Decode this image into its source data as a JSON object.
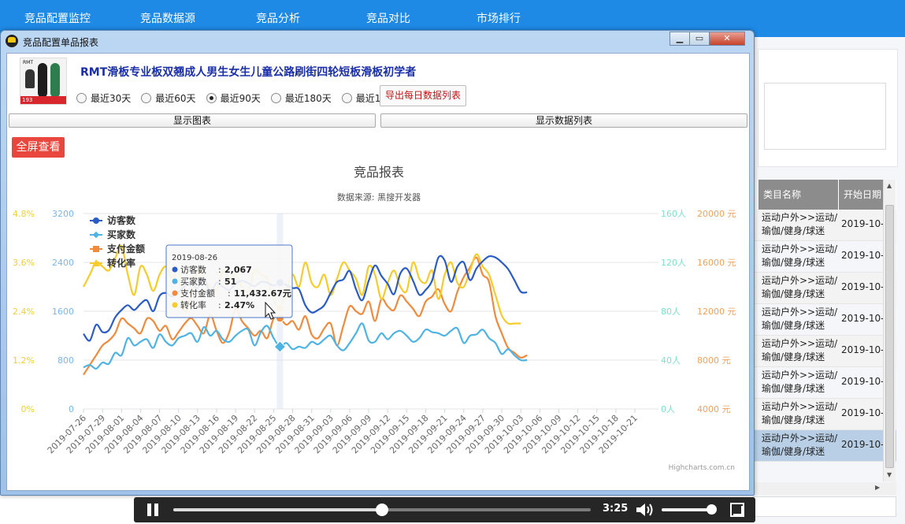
{
  "nav": [
    "竞品配置监控",
    "竞品数据源",
    "竞品分析",
    "竞品对比",
    "市场排行"
  ],
  "window": {
    "title": "竞品配置单品报表"
  },
  "product": {
    "title": "RMT滑板专业板双翘成人男生女生儿童公路刷街四轮短板滑板初学者",
    "thumb_brand": "RMT",
    "thumb_price": "193"
  },
  "ranges": [
    {
      "label": "最近30天",
      "selected": false
    },
    {
      "label": "最近60天",
      "selected": false
    },
    {
      "label": "最近90天",
      "selected": true
    },
    {
      "label": "最近180天",
      "selected": false
    },
    {
      "label": "最近1年",
      "selected": false
    }
  ],
  "buttons": {
    "export": "导出每日数据列表",
    "show_chart": "显示图表",
    "show_list": "显示数据列表",
    "fullscreen": "全屏查看"
  },
  "chart_data": {
    "type": "line",
    "title": "竞品报表",
    "subtitle": "数据来源: 黑搜开发器",
    "credit": "Highcharts.com.cn",
    "legend_position": "top-left",
    "x_start": "2019-07-26",
    "x_end": "2019-10-06",
    "x_tick_labels": [
      "2019-07-26",
      "2019-07-29",
      "2019-08-01",
      "2019-08-04",
      "2019-08-07",
      "2019-08-10",
      "2019-08-13",
      "2019-08-16",
      "2019-08-19",
      "2019-08-22",
      "2019-08-25",
      "2019-08-28",
      "2019-08-31",
      "2019-09-03",
      "2019-09-06",
      "2019-09-09",
      "2019-09-12",
      "2019-09-15",
      "2019-09-18",
      "2019-09-21",
      "2019-09-24",
      "2019-09-27",
      "2019-09-30",
      "2019-10-03",
      "2019-10-06",
      "2019-10-09",
      "2019-10-12",
      "2019-10-15",
      "2019-10-18",
      "2019-10-21"
    ],
    "axes": {
      "rate": {
        "ticks": [
          "0%",
          "1.2%",
          "2.4%",
          "3.6%",
          "4.8%"
        ],
        "range": [
          0,
          4.8
        ],
        "color": "#f1d03b"
      },
      "visitors": {
        "ticks": [
          "0",
          "800",
          "1600",
          "2400",
          "3200"
        ],
        "range": [
          0,
          3200
        ],
        "color": "#7cb5ec"
      },
      "buyers": {
        "ticks": [
          "0人",
          "40人",
          "80人",
          "120人",
          "160人"
        ],
        "range": [
          0,
          160
        ],
        "color": "#7ee0c9"
      },
      "amount": {
        "ticks": [
          "4000 元",
          "8000 元",
          "12000 元",
          "16000 元",
          "20000 元"
        ],
        "range": [
          4000,
          20000
        ],
        "color": "#f3a25d"
      }
    },
    "series": [
      {
        "name": "访客数",
        "color": "#2b5cc5",
        "axis": "visitors",
        "values": [
          1230,
          1120,
          1380,
          1260,
          1290,
          1500,
          1620,
          1700,
          1620,
          1720,
          1780,
          1600,
          1850,
          1900,
          1840,
          1920,
          2010,
          2060,
          1980,
          2150,
          1900,
          2070,
          2000,
          1950,
          2050,
          2100,
          2060,
          2010,
          2080,
          2070,
          2020,
          2067,
          2030,
          1980,
          1960,
          1700,
          1580,
          1620,
          1700,
          1900,
          2080,
          2120,
          2260,
          1960,
          1780,
          2100,
          2350,
          2180,
          2050,
          1880,
          2220,
          2300,
          2100,
          1870,
          1950,
          2100,
          2480,
          2430,
          2080,
          2330,
          2400,
          2110,
          2300,
          2420,
          2500,
          2480,
          2400,
          2290,
          2110,
          1920,
          1910
        ]
      },
      {
        "name": "买家数",
        "color": "#4fb3e4",
        "axis": "buyers",
        "values": [
          34,
          36,
          33,
          38,
          37,
          46,
          44,
          58,
          52,
          55,
          57,
          50,
          61,
          55,
          52,
          58,
          60,
          62,
          55,
          67,
          60,
          64,
          57,
          55,
          60,
          64,
          65,
          52,
          63,
          68,
          58,
          51,
          54,
          49,
          51,
          50,
          55,
          53,
          57,
          60,
          52,
          48,
          54,
          62,
          70,
          56,
          55,
          62,
          57,
          62,
          64,
          60,
          55,
          58,
          65,
          63,
          62,
          60,
          64,
          66,
          54,
          60,
          61,
          65,
          58,
          54,
          45,
          49,
          44,
          40,
          40
        ]
      },
      {
        "name": "支付金额",
        "color": "#f08a3c",
        "axis": "amount",
        "values": [
          6800,
          7600,
          8400,
          9200,
          9600,
          10200,
          11400,
          11000,
          10600,
          10200,
          11400,
          11200,
          10400,
          10800,
          9700,
          10300,
          11000,
          11432.67,
          10800,
          10200,
          11700,
          10400,
          9400,
          10300,
          12200,
          11200,
          10600,
          10000,
          10400,
          9800,
          11400,
          11432.67,
          10900,
          11200,
          10500,
          11600,
          10100,
          9800,
          10600,
          11000,
          9200,
          10800,
          12400,
          12000,
          11800,
          12800,
          11200,
          13000,
          12400,
          12100,
          13300,
          12800,
          12200,
          11600,
          12800,
          13200,
          13800,
          12600,
          12000,
          13600,
          14800,
          15600,
          16400,
          15000,
          14400,
          11600,
          10200,
          9000,
          8600,
          8200,
          8400
        ]
      },
      {
        "name": "转化率",
        "color": "#f5cc2c",
        "axis": "rate",
        "values": [
          3.0,
          3.3,
          3.6,
          3.5,
          3.4,
          3.7,
          4.0,
          3.3,
          2.8,
          3.5,
          3.3,
          2.9,
          3.3,
          3.5,
          3.2,
          3.4,
          2.4,
          2.8,
          3.4,
          3.2,
          3.0,
          2.9,
          3.4,
          3.2,
          3.3,
          3.0,
          2.9,
          3.4,
          3.3,
          3.2,
          2.7,
          2.47,
          2.9,
          3.3,
          3.0,
          3.6,
          3.1,
          3.0,
          3.3,
          2.8,
          3.2,
          3.6,
          3.4,
          3.2,
          2.8,
          3.5,
          3.3,
          2.7,
          3.1,
          3.4,
          3.0,
          2.9,
          3.6,
          3.2,
          3.1,
          3.4,
          2.7,
          3.3,
          3.6,
          3.1,
          3.0,
          3.4,
          3.8,
          3.5,
          3.3,
          2.8,
          2.3,
          2.1,
          2.1,
          2.1
        ]
      }
    ],
    "highlight_index": 31,
    "tooltip": {
      "date": "2019-08-26",
      "rows": [
        {
          "label": "访客数",
          "value": "2,067",
          "color": "#2b5cc5"
        },
        {
          "label": "买家数",
          "value": "51",
          "color": "#4fb3e4"
        },
        {
          "label": "支付金额",
          "value": "11,432.67元",
          "color": "#f08a3c"
        },
        {
          "label": "转化率",
          "value": "2.47%",
          "color": "#f5cc2c"
        }
      ]
    }
  },
  "bg_table": {
    "headers": [
      "类目名称",
      "开始日期"
    ],
    "rows": [
      {
        "category": "运动户外>>运动/瑜伽/健身/球迷",
        "date": "2019-10-"
      },
      {
        "category": "运动户外>>运动/瑜伽/健身/球迷",
        "date": "2019-10-"
      },
      {
        "category": "运动户外>>运动/瑜伽/健身/球迷",
        "date": "2019-10-"
      },
      {
        "category": "运动户外>>运动/瑜伽/健身/球迷",
        "date": "2019-10-"
      },
      {
        "category": "运动户外>>运动/瑜伽/健身/球迷",
        "date": "2019-10-"
      },
      {
        "category": "运动户外>>运动/瑜伽/健身/球迷",
        "date": "2019-10-"
      },
      {
        "category": "运动户外>>运动/瑜伽/健身/球迷",
        "date": "2019-10-"
      },
      {
        "category": "运动户外>>运动/瑜伽/健身/球迷",
        "date": "2019-10-"
      }
    ],
    "selected_row": 7
  },
  "video": {
    "time": "3:25",
    "progress": 0.5,
    "volume": 0.95
  }
}
